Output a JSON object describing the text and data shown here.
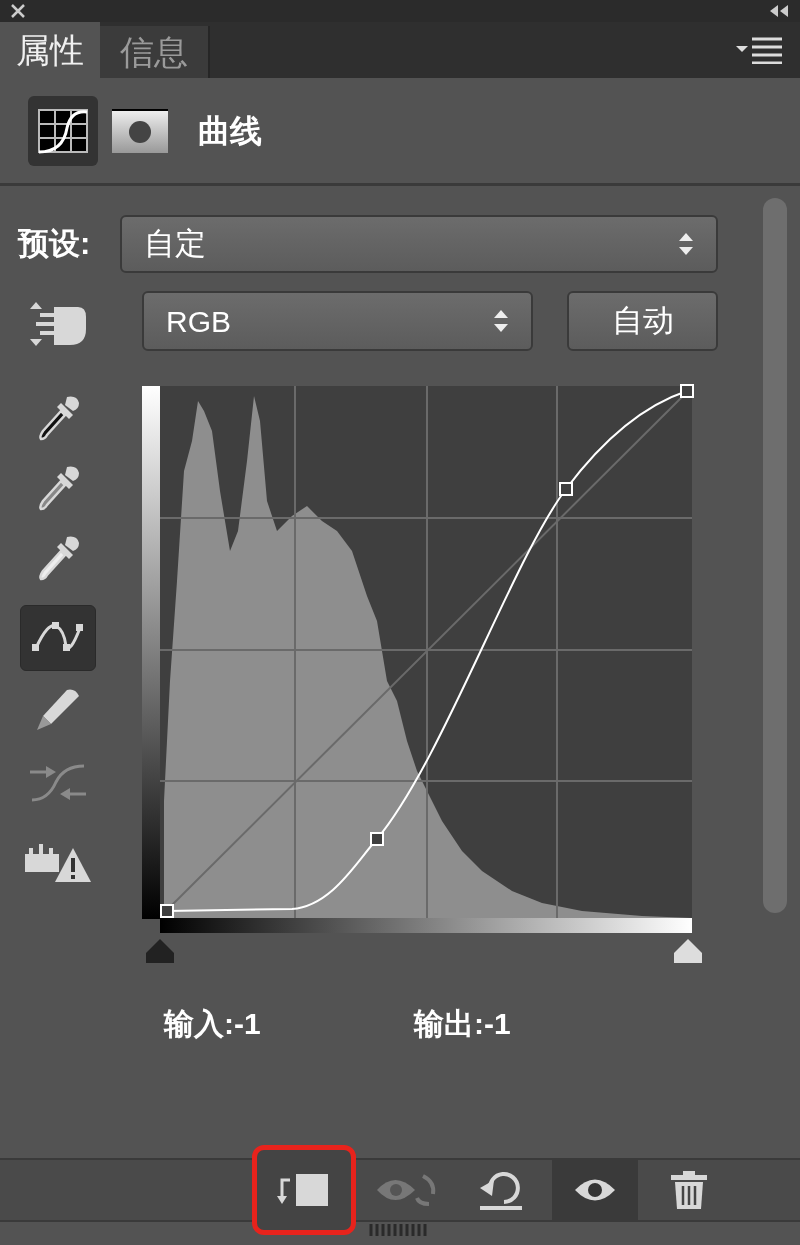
{
  "tabs": [
    {
      "label": "属性",
      "selected": true
    },
    {
      "label": "信息",
      "selected": false
    }
  ],
  "header": {
    "title": "曲线",
    "icons": [
      {
        "kind": "adjustment",
        "selected": true
      },
      {
        "kind": "mask",
        "selected": false
      }
    ]
  },
  "preset": {
    "label": "预设:",
    "value": "自定"
  },
  "channel": {
    "value": "RGB"
  },
  "auto_button": "自动",
  "tools": [
    {
      "kind": "hand",
      "selected": false,
      "disabled": false
    },
    {
      "kind": "dropper-black",
      "selected": false,
      "disabled": false
    },
    {
      "kind": "dropper-gray",
      "selected": false,
      "disabled": false
    },
    {
      "kind": "dropper-white",
      "selected": false,
      "disabled": false
    },
    {
      "kind": "curve-points",
      "selected": true,
      "disabled": false
    },
    {
      "kind": "pencil",
      "selected": false,
      "disabled": false
    },
    {
      "kind": "smooth",
      "selected": false,
      "disabled": true
    },
    {
      "kind": "clipping",
      "selected": false,
      "disabled": false
    }
  ],
  "input_label": "输入:-1",
  "output_label": "输出:-1",
  "bottom_buttons": [
    {
      "kind": "clip",
      "highlighted": true,
      "selected": false,
      "disabled": false
    },
    {
      "kind": "view-previous",
      "highlighted": false,
      "selected": false,
      "disabled": true
    },
    {
      "kind": "reset",
      "highlighted": false,
      "selected": false,
      "disabled": false
    },
    {
      "kind": "visibility",
      "highlighted": false,
      "selected": true,
      "disabled": false
    },
    {
      "kind": "delete",
      "highlighted": false,
      "selected": false,
      "disabled": false
    }
  ]
}
